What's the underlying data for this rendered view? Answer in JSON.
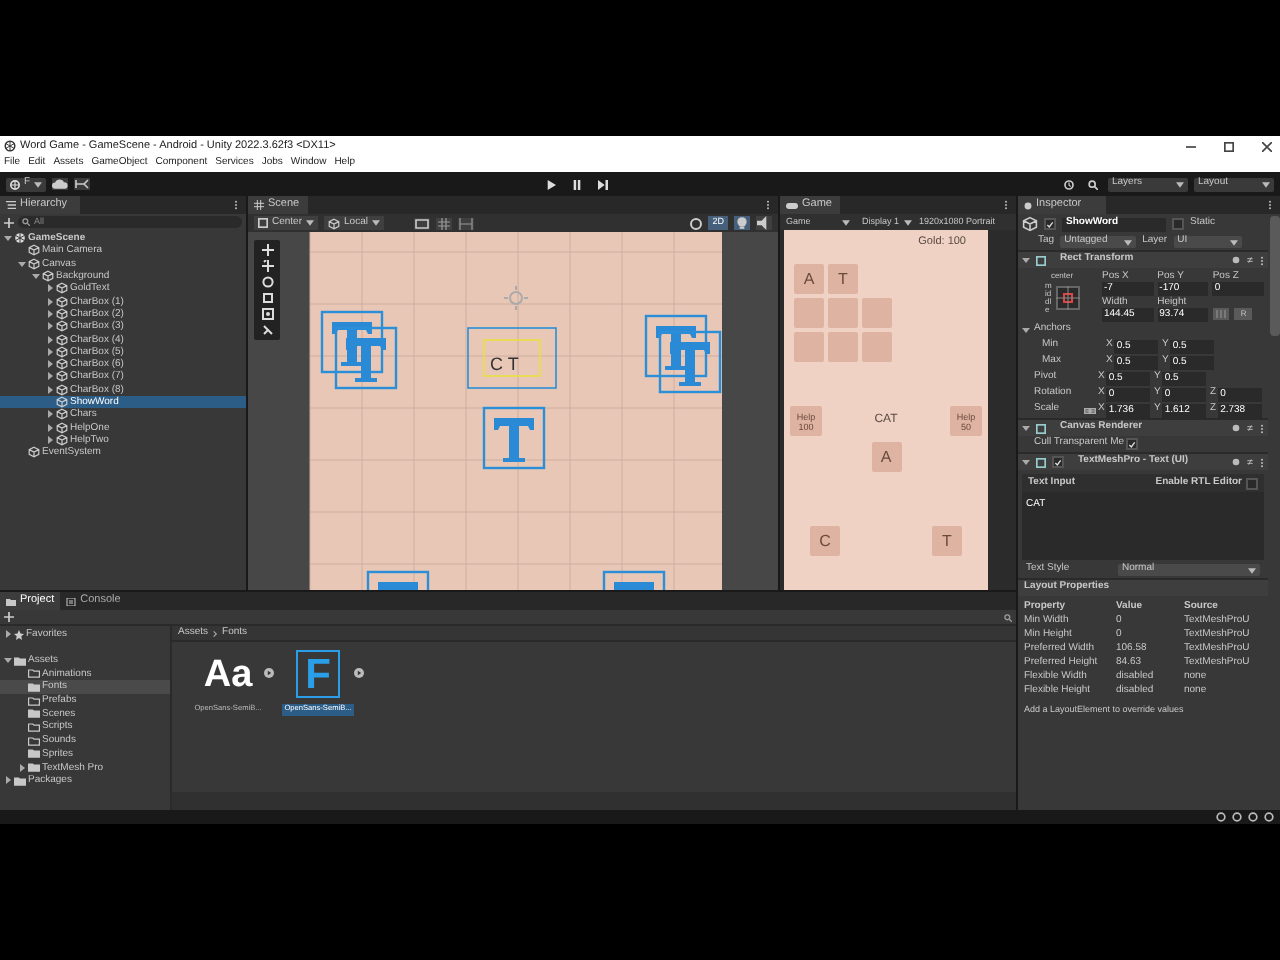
{
  "window": {
    "title": "Word Game - GameScene - Android - Unity 2022.3.62f3 <DX11>"
  },
  "menu": [
    "File",
    "Edit",
    "Assets",
    "GameObject",
    "Component",
    "Services",
    "Jobs",
    "Window",
    "Help"
  ],
  "toolbar": {
    "account": "F",
    "layers": "Layers",
    "layout": "Layout"
  },
  "hierarchy": {
    "tab": "Hierarchy",
    "search": "All",
    "tree": [
      {
        "label": "GameScene",
        "kind": "scene",
        "expanded": true,
        "selected": false,
        "children": [
          {
            "label": "Main Camera",
            "kind": "object",
            "selected": false
          },
          {
            "label": "Canvas",
            "kind": "object",
            "expanded": true,
            "selected": false,
            "children": [
              {
                "label": "Background",
                "kind": "object",
                "expanded": true,
                "selected": false,
                "children": [
                  {
                    "label": "GoldText",
                    "kind": "object",
                    "expanded": false,
                    "selected": false
                  },
                  {
                    "label": "CharBox (1)",
                    "kind": "object",
                    "expanded": false,
                    "selected": false
                  },
                  {
                    "label": "CharBox (2)",
                    "kind": "object",
                    "expanded": false,
                    "selected": false
                  },
                  {
                    "label": "CharBox (3)",
                    "kind": "object",
                    "expanded": false,
                    "selected": false
                  },
                  {
                    "label": "CharBox (4)",
                    "kind": "object",
                    "expanded": false,
                    "selected": false
                  },
                  {
                    "label": "CharBox (5)",
                    "kind": "object",
                    "expanded": false,
                    "selected": false
                  },
                  {
                    "label": "CharBox (6)",
                    "kind": "object",
                    "expanded": false,
                    "selected": false
                  },
                  {
                    "label": "CharBox (7)",
                    "kind": "object",
                    "expanded": false,
                    "selected": false
                  },
                  {
                    "label": "CharBox (8)",
                    "kind": "object",
                    "expanded": false,
                    "selected": false
                  },
                  {
                    "label": "ShowWord",
                    "kind": "object",
                    "selected": true
                  },
                  {
                    "label": "Chars",
                    "kind": "object",
                    "expanded": false,
                    "selected": false
                  },
                  {
                    "label": "HelpOne",
                    "kind": "object",
                    "expanded": false,
                    "selected": false
                  },
                  {
                    "label": "HelpTwo",
                    "kind": "object",
                    "expanded": false,
                    "selected": false
                  }
                ]
              }
            ]
          },
          {
            "label": "EventSystem",
            "kind": "object",
            "selected": false
          }
        ]
      }
    ]
  },
  "scene": {
    "tab": "Scene",
    "pivot": "Center",
    "space": "Local",
    "mode": "2D",
    "label": "C T"
  },
  "game": {
    "tab": "Game",
    "view": "Game",
    "display": "Display 1",
    "resolution": "1920x1080 Portrait",
    "gold": "Gold: 100",
    "tile_rows": [
      [
        {
          "kind": "letter",
          "letter": "A"
        },
        {
          "kind": "letter",
          "letter": "T"
        }
      ],
      [
        {
          "kind": "empty"
        },
        {
          "kind": "empty"
        },
        {
          "kind": "empty"
        }
      ],
      [
        {
          "kind": "empty"
        },
        {
          "kind": "empty"
        },
        {
          "kind": "empty"
        }
      ]
    ],
    "help_buttons": [
      {
        "label": "Help",
        "cost": "100"
      },
      {
        "label": "Help",
        "cost": "50"
      }
    ],
    "word": "CAT",
    "middle_char": "A",
    "bottom_chars": [
      "C",
      "T"
    ]
  },
  "inspector": {
    "tab": "Inspector",
    "object": {
      "enabled": true,
      "name": "ShowWord",
      "static_label": "Static",
      "static": false,
      "tag_label": "Tag",
      "tag": "Untagged",
      "layer_label": "Layer",
      "layer": "UI"
    },
    "rect_transform": {
      "title": "Rect Transform",
      "anchor_h": "center",
      "anchor_v": "middle",
      "fields": [
        {
          "label": "Pos X",
          "value": "-7"
        },
        {
          "label": "Pos Y",
          "value": "-170"
        },
        {
          "label": "Pos Z",
          "value": "0"
        },
        {
          "label": "Width",
          "value": "144.45"
        },
        {
          "label": "Height",
          "value": "93.74"
        }
      ],
      "raw_button": "R",
      "anchors_label": "Anchors",
      "vectors": [
        {
          "label": "Min",
          "kind": "anchor",
          "axes": [
            {
              "axis": "X",
              "value": "0.5"
            },
            {
              "axis": "Y",
              "value": "0.5"
            }
          ]
        },
        {
          "label": "Max",
          "kind": "anchor",
          "axes": [
            {
              "axis": "X",
              "value": "0.5"
            },
            {
              "axis": "Y",
              "value": "0.5"
            }
          ]
        },
        {
          "label": "Pivot",
          "kind": "plain",
          "axes": [
            {
              "axis": "X",
              "value": "0.5"
            },
            {
              "axis": "Y",
              "value": "0.5"
            }
          ]
        },
        {
          "label": "Rotation",
          "kind": "plain",
          "axes": [
            {
              "axis": "X",
              "value": "0"
            },
            {
              "axis": "Y",
              "value": "0"
            },
            {
              "axis": "Z",
              "value": "0"
            }
          ]
        },
        {
          "label": "Scale",
          "kind": "linked",
          "axes": [
            {
              "axis": "X",
              "value": "1.736"
            },
            {
              "axis": "Y",
              "value": "1.612"
            },
            {
              "axis": "Z",
              "value": "2.738"
            }
          ]
        }
      ]
    },
    "canvas_renderer": {
      "title": "Canvas Renderer",
      "cull_label": "Cull Transparent Me",
      "cull": true
    },
    "tmp": {
      "title": "TextMeshPro - Text (UI)",
      "enabled": true,
      "text_input_label": "Text Input",
      "rtl_label": "Enable RTL Editor",
      "rtl": false,
      "text": "CAT",
      "style_label": "Text Style",
      "style": "Normal"
    },
    "layout": {
      "title": "Layout Properties",
      "columns": [
        "Property",
        "Value",
        "Source"
      ],
      "rows": [
        [
          "Min Width",
          "0",
          "TextMeshProU"
        ],
        [
          "Min Height",
          "0",
          "TextMeshProU"
        ],
        [
          "Preferred Width",
          "106.58",
          "TextMeshProU"
        ],
        [
          "Preferred Height",
          "84.63",
          "TextMeshProU"
        ],
        [
          "Flexible Width",
          "disabled",
          "none"
        ],
        [
          "Flexible Height",
          "disabled",
          "none"
        ]
      ],
      "note": "Add a LayoutElement to override values"
    }
  },
  "project": {
    "tabs": [
      {
        "label": "Project",
        "selected": true
      },
      {
        "label": "Console",
        "selected": false
      }
    ],
    "tree": [
      {
        "label": "Favorites",
        "kind": "favorites",
        "expanded": false,
        "selected": false
      },
      {
        "label": "Assets",
        "kind": "folder",
        "expanded": true,
        "selected": false,
        "children": [
          {
            "label": "Animations",
            "kind": "folder_empty",
            "selected": false
          },
          {
            "label": "Fonts",
            "kind": "folder",
            "selected": true
          },
          {
            "label": "Prefabs",
            "kind": "folder_empty",
            "selected": false
          },
          {
            "label": "Scenes",
            "kind": "folder",
            "selected": false
          },
          {
            "label": "Scripts",
            "kind": "folder_empty",
            "selected": false
          },
          {
            "label": "Sounds",
            "kind": "folder_empty",
            "selected": false
          },
          {
            "label": "Sprites",
            "kind": "folder",
            "selected": false
          },
          {
            "label": "TextMesh Pro",
            "kind": "folder",
            "expanded": false,
            "selected": false
          }
        ]
      },
      {
        "label": "Packages",
        "kind": "folder",
        "expanded": false,
        "selected": false
      }
    ],
    "breadcrumb": [
      "Assets",
      "Fonts"
    ],
    "assets": [
      {
        "kind": "font",
        "preview": "Aa",
        "label": "OpenSans-SemiB...",
        "selected": false
      },
      {
        "kind": "font_asset",
        "preview": "F",
        "label": "OpenSans-SemiB...",
        "selected": true
      }
    ]
  }
}
